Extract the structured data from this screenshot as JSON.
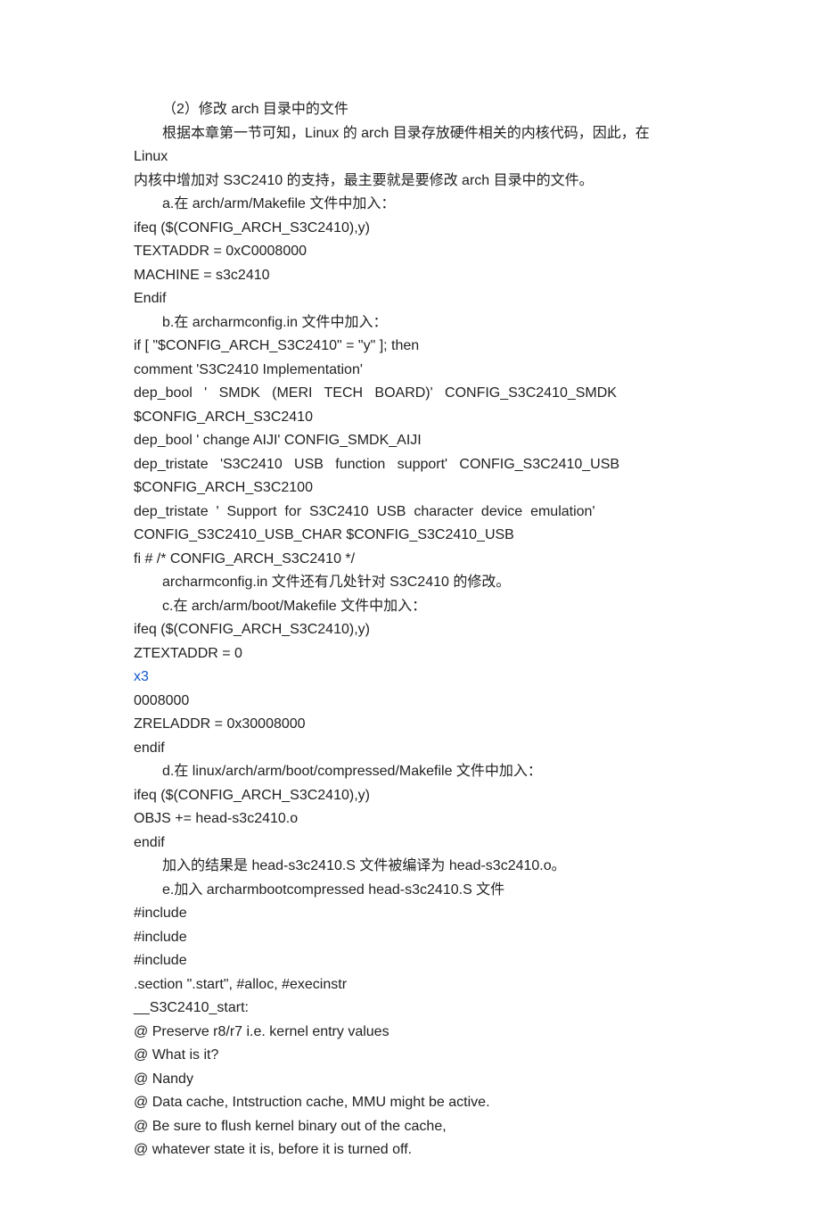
{
  "lines": [
    {
      "text": "（2）修改 arch 目录中的文件",
      "indent": true
    },
    {
      "text": "根据本章第一节可知，Linux 的 arch 目录存放硬件相关的内核代码，因此，在 Linux",
      "indent": true
    },
    {
      "text": "内核中增加对 S3C2410 的支持，最主要就是要修改 arch 目录中的文件。"
    },
    {
      "text": "a.在 arch/arm/Makefile 文件中加入：",
      "indent": true
    },
    {
      "text": "ifeq ($(CONFIG_ARCH_S3C2410),y)"
    },
    {
      "text": "TEXTADDR = 0xC0008000"
    },
    {
      "text": "MACHINE = s3c2410"
    },
    {
      "text": "Endif"
    },
    {
      "text": "b.在 archarmconfig.in 文件中加入：",
      "indent": true
    },
    {
      "text": "if [ \"$CONFIG_ARCH_S3C2410\" = \"y\" ]; then"
    },
    {
      "text": "comment 'S3C2410 Implementation'"
    },
    {
      "text": "dep_bool   '   SMDK   (MERI   TECH   BOARD)'   CONFIG_S3C2410_SMDK"
    },
    {
      "text": "$CONFIG_ARCH_S3C2410"
    },
    {
      "text": "dep_bool ' change AIJI' CONFIG_SMDK_AIJI"
    },
    {
      "text": "dep_tristate   'S3C2410   USB   function   support'   CONFIG_S3C2410_USB"
    },
    {
      "text": "$CONFIG_ARCH_S3C2100"
    },
    {
      "text": "dep_tristate  '  Support  for  S3C2410  USB  character  device  emulation'"
    },
    {
      "text": "CONFIG_S3C2410_USB_CHAR $CONFIG_S3C2410_USB"
    },
    {
      "text": "fi # /* CONFIG_ARCH_S3C2410 */"
    },
    {
      "text": "archarmconfig.in 文件还有几处针对 S3C2410 的修改。",
      "indent": true
    },
    {
      "text": "c.在 arch/arm/boot/Makefile 文件中加入：",
      "indent": true
    },
    {
      "text": "ifeq ($(CONFIG_ARCH_S3C2410),y)"
    },
    {
      "text": "ZTEXTADDR = 0"
    },
    {
      "text": "x3",
      "link": true
    },
    {
      "text": "0008000"
    },
    {
      "text": "ZRELADDR = 0x30008000"
    },
    {
      "text": "endif"
    },
    {
      "text": "d.在 linux/arch/arm/boot/compressed/Makefile 文件中加入：",
      "indent": true
    },
    {
      "text": "ifeq ($(CONFIG_ARCH_S3C2410),y)"
    },
    {
      "text": "OBJS += head-s3c2410.o"
    },
    {
      "text": "endif"
    },
    {
      "text": "加入的结果是 head-s3c2410.S 文件被编译为 head-s3c2410.o。",
      "indent": true
    },
    {
      "text": "e.加入 archarmbootcompressed head-s3c2410.S 文件",
      "indent": true
    },
    {
      "text": "#include"
    },
    {
      "text": "#include"
    },
    {
      "text": "#include"
    },
    {
      "text": ".section \".start\", #alloc, #execinstr"
    },
    {
      "text": "__S3C2410_start:"
    },
    {
      "text": "@ Preserve r8/r7 i.e. kernel entry values"
    },
    {
      "text": "@ What is it?"
    },
    {
      "text": "@ Nandy"
    },
    {
      "text": "@ Data cache, Intstruction cache, MMU might be active."
    },
    {
      "text": "@ Be sure to flush kernel binary out of the cache,"
    },
    {
      "text": "@ whatever state it is, before it is turned off."
    }
  ]
}
